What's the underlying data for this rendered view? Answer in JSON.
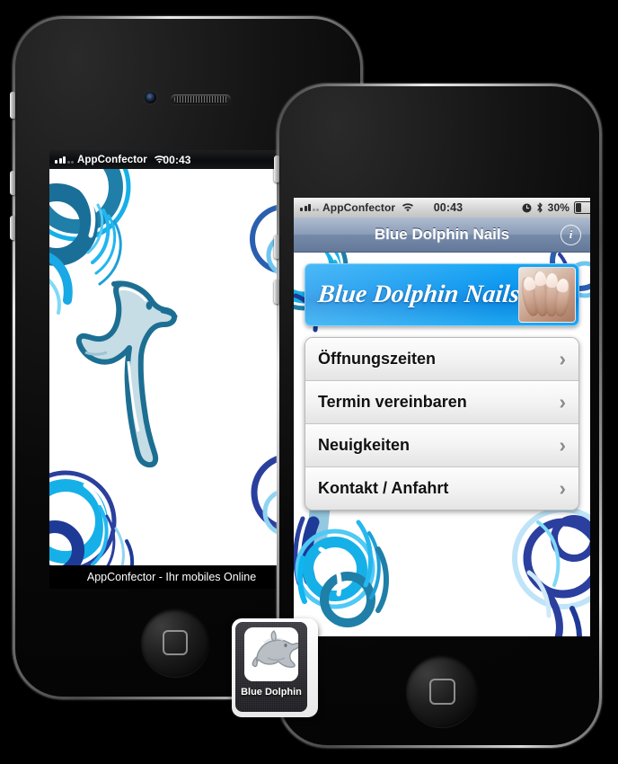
{
  "background_color": "#000000",
  "back_phone": {
    "status_bar": {
      "carrier": "AppConfector",
      "time": "00:43",
      "signal_icon": "signal-dots-icon",
      "wifi_icon": "wifi-icon",
      "alarm_icon": "alarm-clock-icon"
    },
    "footer_text": "AppConfector - Ihr mobiles Online",
    "wallpaper": "blue-dolphin-swirl-artwork"
  },
  "front_phone": {
    "status_bar": {
      "carrier": "AppConfector",
      "time": "00:43",
      "battery_percent": "30%",
      "battery_level": 30,
      "signal_icon": "signal-dots-icon",
      "wifi_icon": "wifi-icon",
      "alarm_icon": "alarm-clock-icon",
      "bluetooth_icon": "bluetooth-icon",
      "battery_icon": "battery-icon"
    },
    "navbar": {
      "title": "Blue Dolphin Nails",
      "info_button_label": "i",
      "gradient_top": "#b0bdd0",
      "gradient_bottom": "#64789a"
    },
    "banner": {
      "logo_text": "Blue Dolphin Nails",
      "background_color": "#0c95ee",
      "photo_name": "manicured-nails-photo"
    },
    "menu": {
      "items": [
        {
          "label": "Öffnungszeiten",
          "chevron": "›"
        },
        {
          "label": "Termin vereinbaren",
          "chevron": "›"
        },
        {
          "label": "Neuigkeiten",
          "chevron": "›"
        },
        {
          "label": "Kontakt / Anfahrt",
          "chevron": "›"
        }
      ]
    },
    "wallpaper": "blue-swirl-artwork"
  },
  "app_icon": {
    "label": "Blue Dolphin",
    "glyph": "dolphin-icon"
  }
}
